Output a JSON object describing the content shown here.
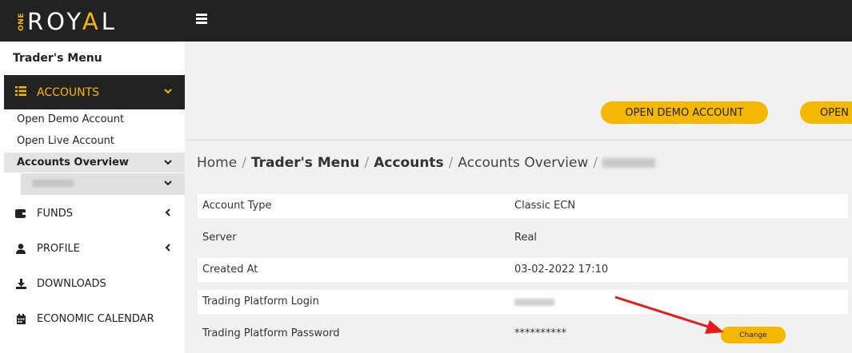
{
  "brand": {
    "small": "ONE",
    "name_part1": "ROY",
    "name_accent": "A",
    "name_part2": "L"
  },
  "sidebar": {
    "title": "Trader's Menu",
    "accounts": {
      "label": "ACCOUNTS",
      "items": [
        "Open Demo Account",
        "Open Live Account"
      ],
      "active": "Accounts Overview"
    },
    "nav": [
      {
        "label": "FUNDS",
        "icon": "wallet-icon"
      },
      {
        "label": "PROFILE",
        "icon": "user-icon"
      },
      {
        "label": "DOWNLOADS",
        "icon": "download-icon"
      },
      {
        "label": "ECONOMIC CALENDAR",
        "icon": "calendar-icon"
      }
    ]
  },
  "actions": {
    "open_demo": "OPEN DEMO ACCOUNT",
    "open_live": "OPEN"
  },
  "breadcrumb": [
    "Home",
    "Trader's Menu",
    "Accounts",
    "Accounts Overview"
  ],
  "details": [
    {
      "label": "Account Type",
      "value": "Classic ECN"
    },
    {
      "label": "Server",
      "value": "Real"
    },
    {
      "label": "Created At",
      "value": "03-02-2022 17:10"
    },
    {
      "label": "Trading Platform Login",
      "value": ""
    },
    {
      "label": "Trading Platform Password",
      "value": "**********"
    }
  ],
  "change_label": "Change",
  "colors": {
    "accent": "#f5b800",
    "dark": "#222222",
    "annotation": "#e8191a"
  }
}
